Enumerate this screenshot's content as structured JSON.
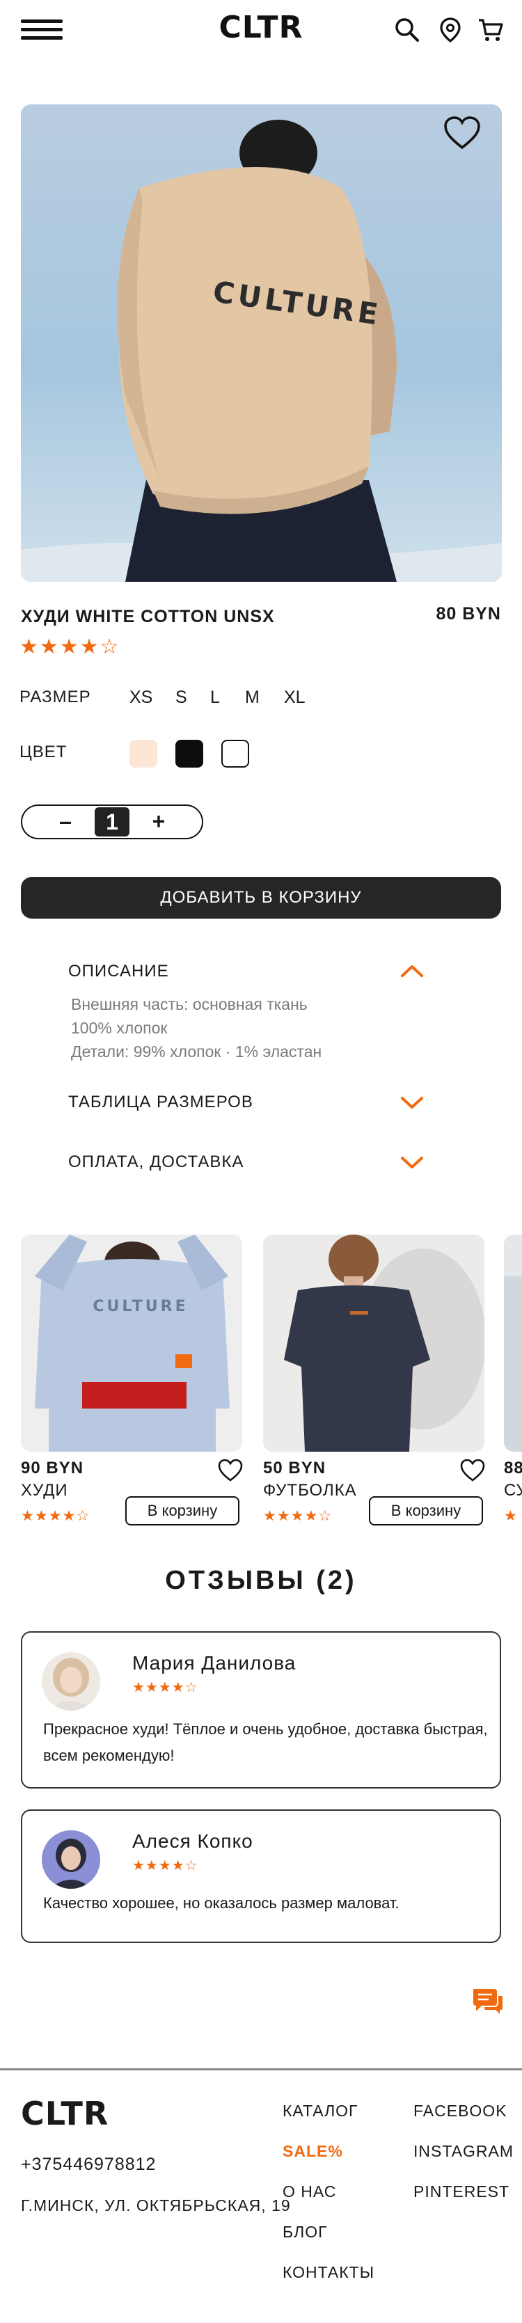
{
  "header": {
    "logo": "CLTR",
    "icons": [
      "menu-icon",
      "search-icon",
      "location-icon",
      "cart-icon"
    ]
  },
  "product": {
    "image_text": "CULTURE",
    "title": "ХУДИ WHITE COTTON UNSX",
    "price": "80 BYN",
    "rating_stars": "★★★★☆",
    "rating": 4,
    "size_label": "РАЗМЕР",
    "sizes": [
      "XS",
      "S",
      "L",
      "M",
      "XL"
    ],
    "color_label": "ЦВЕТ",
    "colors": [
      "#fde6d6",
      "#0d0d0d",
      "#ffffff"
    ],
    "quantity": "1",
    "minus": "–",
    "plus": "+",
    "add_to_cart": "ДОБАВИТЬ В КОРЗИНУ"
  },
  "accordion": {
    "description_title": "ОПИСАНИЕ",
    "description_lines": [
      "Внешняя часть: основная ткань",
      "100% хлопок",
      "Детали: 99% хлопок · 1% эластан"
    ],
    "size_table_title": "ТАБЛИЦА РАЗМЕРОВ",
    "payment_title": "ОПЛАТА, ДОСТАВКА"
  },
  "related": [
    {
      "price": "90 BYN",
      "name": "ХУДИ",
      "stars": "★★★★☆",
      "button": "В корзину",
      "image_text": "CULTURE"
    },
    {
      "price": "50 BYN",
      "name": "ФУТБОЛКА",
      "stars": "★★★★☆",
      "button": "В корзину"
    },
    {
      "price": "88",
      "name": "СУ",
      "stars": "★"
    }
  ],
  "reviews": {
    "heading": "ОТЗЫВЫ (2)",
    "items": [
      {
        "name": "Мария Данилова",
        "stars": "★★★★☆",
        "text": "Прекрасное худи! Тёплое и очень удобное, доставка быстрая, всем рекомендую!"
      },
      {
        "name": "Алеся Копко",
        "stars": "★★★★☆",
        "text": "Качество хорошее, но оказалось размер маловат."
      }
    ]
  },
  "footer": {
    "logo": "CLTR",
    "phone": "+375446978812",
    "address": "Г.МИНСК, УЛ. ОКТЯБРЬСКАЯ, 19",
    "nav": [
      "КАТАЛОГ",
      "SALE%",
      "О НАС",
      "БЛОГ",
      "КОНТАКТЫ"
    ],
    "social": [
      "FACEBOOK",
      "INSTAGRAM",
      "PINTEREST"
    ]
  },
  "colors": {
    "accent": "#f26a10",
    "dark": "#262626"
  }
}
